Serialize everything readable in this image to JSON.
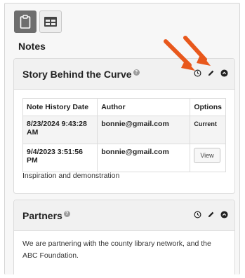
{
  "tabs": [
    {
      "icon": "clipboard-icon",
      "active": true
    },
    {
      "icon": "grid-icon",
      "active": false
    }
  ],
  "section_title": "Notes",
  "card1": {
    "title": "Story Behind the Curve",
    "help": "?",
    "headers": [
      "Note History Date",
      "Author",
      "Options"
    ],
    "rows": [
      {
        "date": "8/23/2024 9:43:28 AM",
        "author": "bonnie@gmail.com",
        "option": "Current"
      },
      {
        "date": "9/4/2023 3:51:56 PM",
        "author": "bonnie@gmail.com",
        "option": "View"
      }
    ],
    "description": "Inspiration and demonstration"
  },
  "card2": {
    "title": "Partners",
    "help": "?",
    "body": "We are partnering with the county library network, and the ABC Foundation."
  },
  "colors": {
    "arrow": "#e8581c",
    "active_tab": "#6e6e6e"
  }
}
